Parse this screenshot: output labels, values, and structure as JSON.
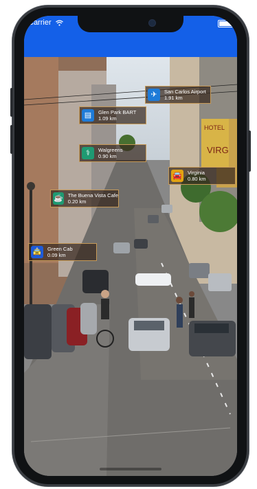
{
  "status_bar": {
    "carrier": "Carrier"
  },
  "pois": [
    {
      "name": "San Carlos Airport",
      "distance": "1.91 km",
      "icon": "airplane-icon",
      "icon_color": "#1e7bd8"
    },
    {
      "name": "Glen Park BART",
      "distance": "1.09 km",
      "icon": "train-icon",
      "icon_color": "#1e7bd8"
    },
    {
      "name": "Walgreens",
      "distance": "0.90 km",
      "icon": "medical-icon",
      "icon_color": "#1f9a72"
    },
    {
      "name": "Virginia",
      "distance": "0.80 km",
      "icon": "car-icon",
      "icon_color": "#e2a312"
    },
    {
      "name": "The Buena Vista Cafe",
      "distance": "0.20 km",
      "icon": "coffee-icon",
      "icon_color": "#1f9a72"
    },
    {
      "name": "Green Cab",
      "distance": "0.09 km",
      "icon": "taxi-icon",
      "icon_color": "#1e5bd8"
    }
  ],
  "colors": {
    "status_bar": "#1460e8",
    "label_border": "#c79a57",
    "label_bg": "#372820"
  }
}
